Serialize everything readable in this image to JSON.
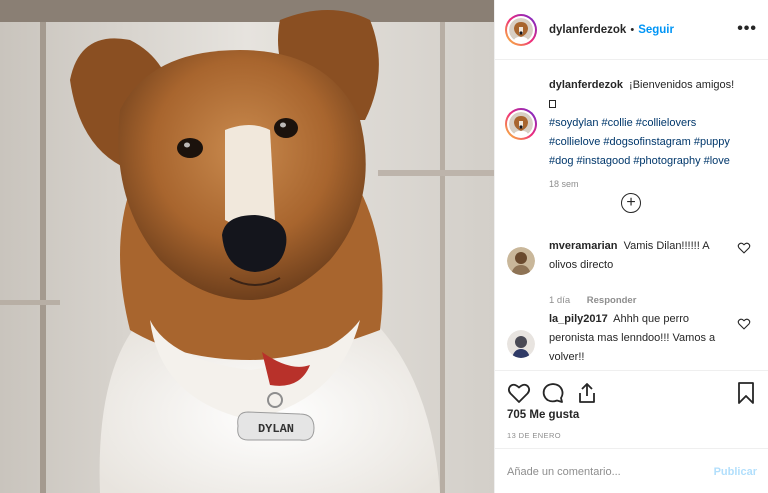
{
  "photo": {
    "tag_text": "DYLAN"
  },
  "header": {
    "username": "dylanferdezok",
    "separator": "•",
    "follow_label": "Seguir",
    "more_label": "•••"
  },
  "caption": {
    "username": "dylanferdezok",
    "text": "¡Bienvenidos amigos!",
    "hashtags": [
      "#soydylan",
      "#collie",
      "#collielovers",
      "#collielove",
      "#dogsofinstagram",
      "#puppy",
      "#dog",
      "#instagood",
      "#photography",
      "#love"
    ],
    "time": "18 sem"
  },
  "load_more": "+",
  "comments": [
    {
      "username": "mveramarian",
      "text": "Vamis Dilan!!!!!! A olivos directo",
      "time": "1 día",
      "reply_label": "Responder"
    },
    {
      "username": "la_pily2017",
      "text": "Ahhh que perro peronista mas lenndoo!!! Vamos a volver!!"
    }
  ],
  "actions": {
    "icons": [
      "heart-icon",
      "comment-icon",
      "share-icon",
      "bookmark-icon"
    ],
    "likes": "705 Me gusta",
    "date": "13 DE ENERO"
  },
  "add_comment": {
    "placeholder": "Añade un comentario...",
    "publish_label": "Publicar"
  },
  "colors": {
    "link": "#0095f6",
    "hashtag": "#00376b",
    "muted": "#8e8e8e",
    "publish_disabled": "#b2dffc"
  }
}
